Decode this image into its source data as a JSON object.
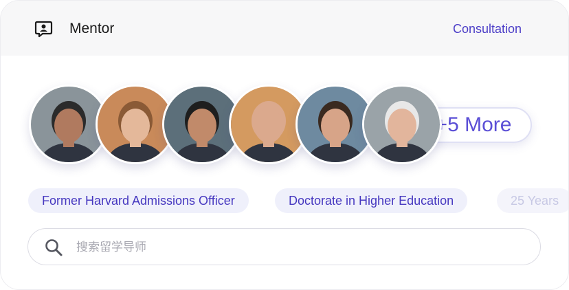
{
  "header": {
    "icon": "mentor-chat-icon",
    "title": "Mentor",
    "consultation_label": "Consultation"
  },
  "mentors": {
    "avatars": [
      {
        "id": "mentor-1",
        "bg": "#8a949a",
        "skin": "#b07a5f",
        "hair": "#2b2b2b"
      },
      {
        "id": "mentor-2",
        "bg": "#c98a5a",
        "skin": "#e4b89a",
        "hair": "#8a5a36"
      },
      {
        "id": "mentor-3",
        "bg": "#5c6f7a",
        "skin": "#c18a6a",
        "hair": "#1e1e1e"
      },
      {
        "id": "mentor-4",
        "bg": "#d49a60",
        "skin": "#dba98d",
        "hair": "#dba98d"
      },
      {
        "id": "mentor-5",
        "bg": "#6e8aa0",
        "skin": "#d7a488",
        "hair": "#3a2a20"
      },
      {
        "id": "mentor-6",
        "bg": "#9aa3a8",
        "skin": "#e2b59c",
        "hair": "#e8e8e8"
      }
    ],
    "more_label": "+5 More"
  },
  "tags": [
    "Former Harvard Admissions Officer",
    "Doctorate in Higher Education",
    "25 Years"
  ],
  "search": {
    "icon": "search-icon",
    "placeholder": "搜索留学导师",
    "value": ""
  },
  "colors": {
    "accent": "#4b3dc7",
    "header_bg": "#f7f7f8",
    "tag_bg": "#eff0fb"
  }
}
